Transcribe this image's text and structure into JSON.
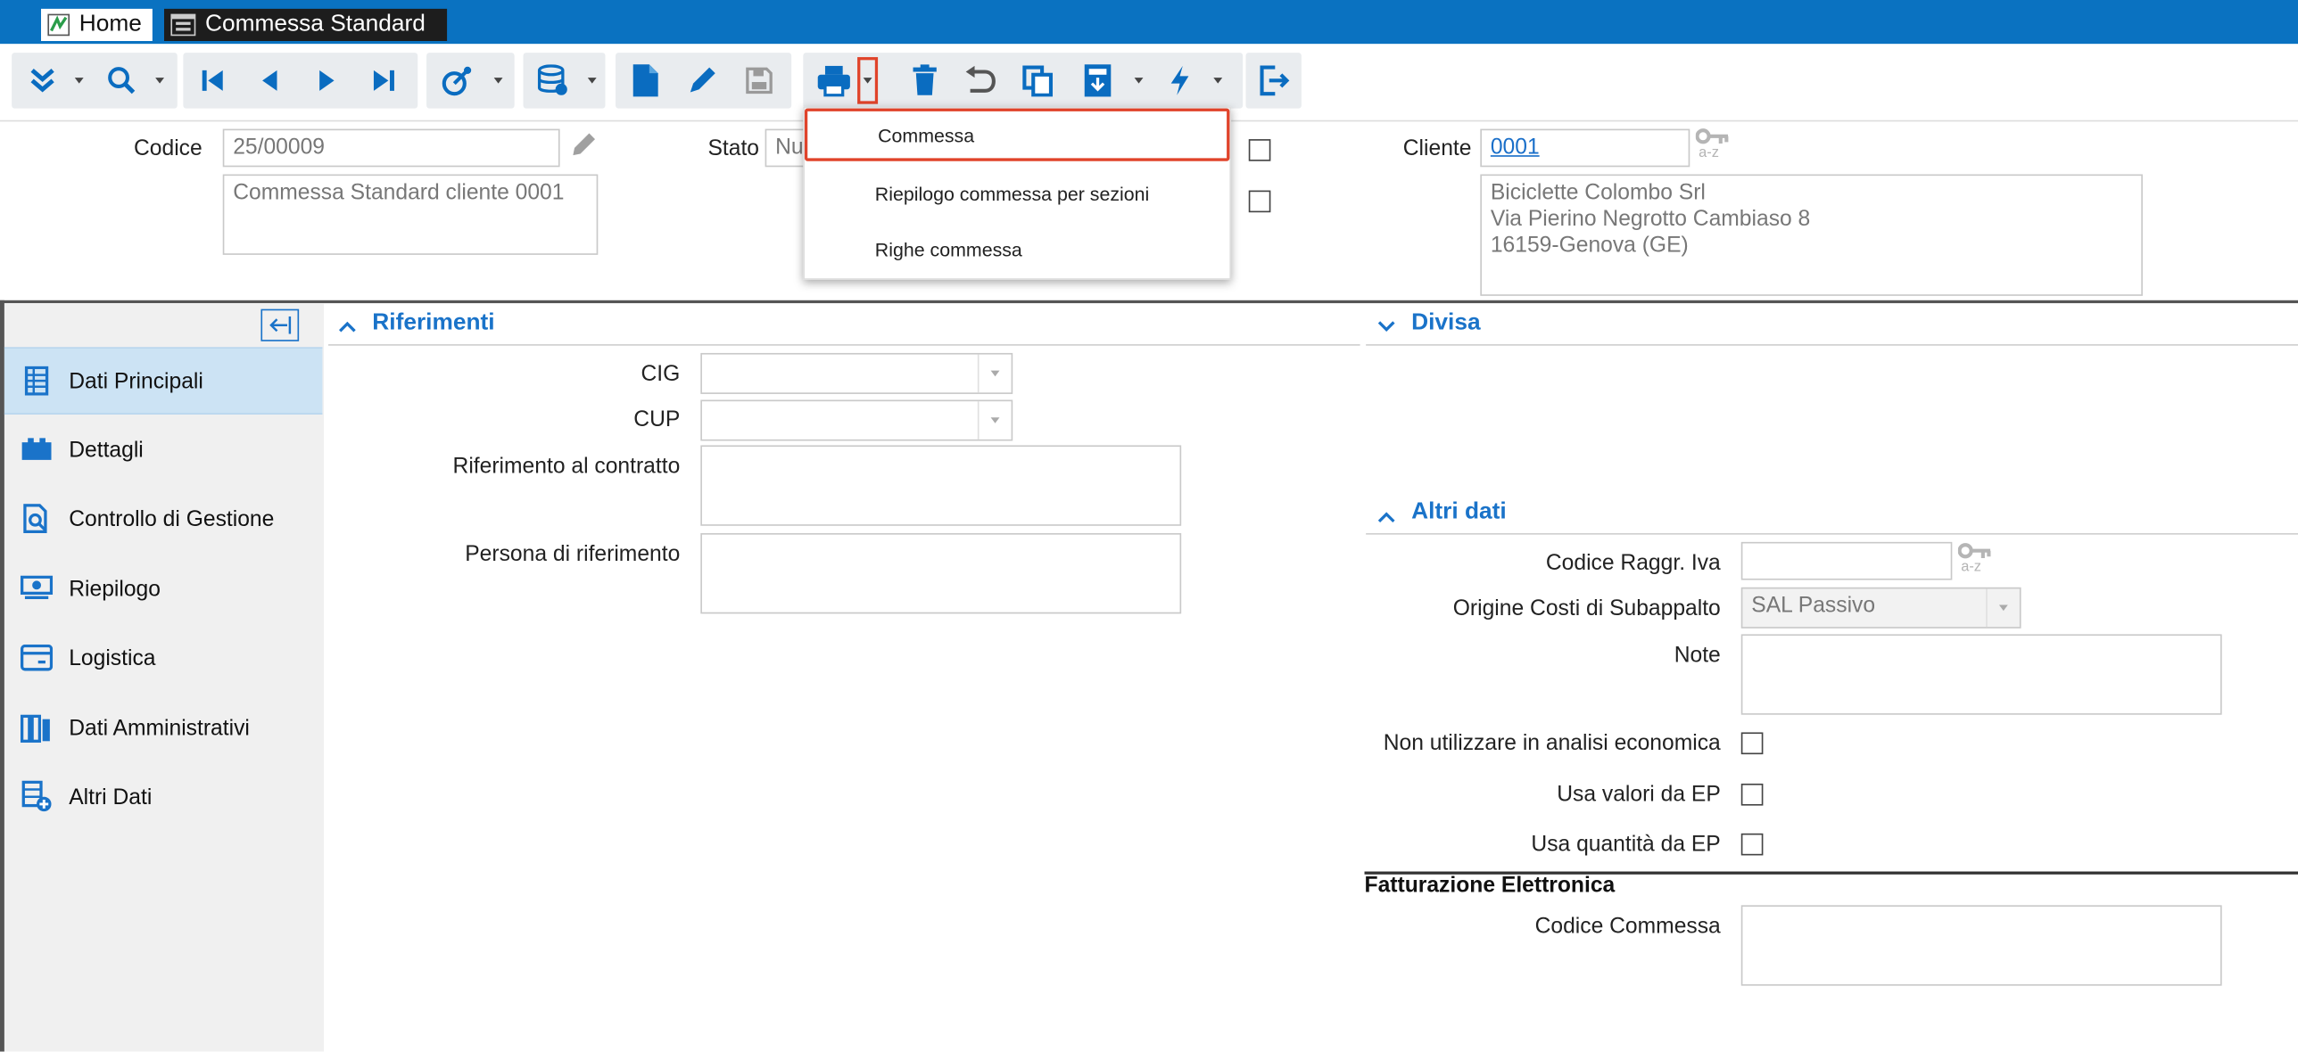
{
  "tabs": {
    "home": "Home",
    "document": "Commessa Standard"
  },
  "toolbar": {
    "icons": [
      "expand-icon",
      "search-icon",
      "first-record-icon",
      "previous-record-icon",
      "next-record-icon",
      "last-record-icon",
      "wizard-icon",
      "database-icon",
      "new-document-icon",
      "edit-icon",
      "save-icon",
      "print-icon",
      "delete-icon",
      "undo-icon",
      "copy-icon",
      "report-icon",
      "lightning-icon",
      "exit-icon"
    ]
  },
  "header": {
    "codice_label": "Codice",
    "codice_value": "25/00009",
    "descrizione_value": "Commessa Standard cliente 0001",
    "stato_label": "Stato",
    "stato_value": "Nu",
    "cliente_label": "Cliente",
    "cliente_value": "0001",
    "key_hint": "a-z",
    "cliente_address": [
      "Biciclette Colombo Srl",
      "Via Pierino Negrotto Cambiaso 8",
      "16159-Genova (GE)"
    ]
  },
  "print_menu": {
    "items": [
      "Commessa",
      "Riepilogo commessa per sezioni",
      "Righe commessa"
    ]
  },
  "sidebar": {
    "items": [
      {
        "label": "Dati Principali",
        "icon": "table-icon"
      },
      {
        "label": "Dettagli",
        "icon": "briefcase-icon"
      },
      {
        "label": "Controllo di Gestione",
        "icon": "report-search-icon"
      },
      {
        "label": "Riepilogo",
        "icon": "money-icon"
      },
      {
        "label": "Logistica",
        "icon": "window-icon"
      },
      {
        "label": "Dati Amministrativi",
        "icon": "books-icon"
      },
      {
        "label": "Altri Dati",
        "icon": "table-add-icon"
      }
    ]
  },
  "riferimenti": {
    "title": "Riferimenti",
    "cig_label": "CIG",
    "cup_label": "CUP",
    "contratto_label": "Riferimento al contratto",
    "persona_label": "Persona di riferimento"
  },
  "divisa": {
    "title": "Divisa"
  },
  "altri_dati": {
    "title": "Altri dati",
    "raggr_iva_label": "Codice Raggr. Iva",
    "origine_label": "Origine Costi di Subappalto",
    "origine_value": "SAL Passivo",
    "note_label": "Note",
    "non_utilizzare_label": "Non utilizzare in analisi economica",
    "usa_valori_label": "Usa valori da EP",
    "usa_quantita_label": "Usa quantità da EP"
  },
  "fatturazione": {
    "title": "Fatturazione Elettronica",
    "codice_commessa_label": "Codice Commessa"
  },
  "colors": {
    "accent": "#1a73c9",
    "tabbar": "#0a72c1",
    "highlight": "#e0432a",
    "sidebar_active": "#cce3f4"
  }
}
